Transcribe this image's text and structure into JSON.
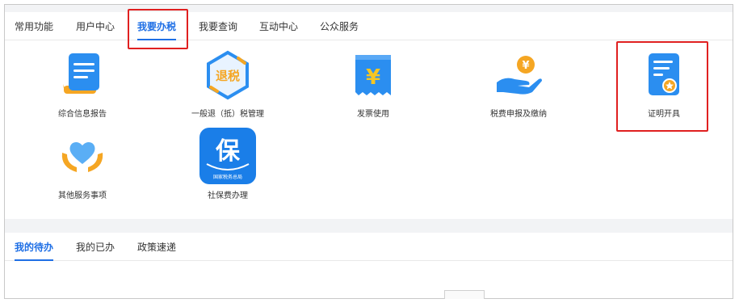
{
  "main_tabs": [
    {
      "label": "常用功能",
      "active": false
    },
    {
      "label": "用户中心",
      "active": false
    },
    {
      "label": "我要办税",
      "active": true
    },
    {
      "label": "我要查询",
      "active": false
    },
    {
      "label": "互动中心",
      "active": false
    },
    {
      "label": "公众服务",
      "active": false
    }
  ],
  "services": [
    {
      "label": "综合信息报告",
      "icon": "document-report-icon"
    },
    {
      "label": "一般退（抵）税管理",
      "icon": "tax-refund-hexagon-icon",
      "icon_text": "退税"
    },
    {
      "label": "发票使用",
      "icon": "invoice-yuan-icon",
      "icon_text": "¥"
    },
    {
      "label": "税费申报及缴纳",
      "icon": "hand-coin-icon",
      "icon_text": "¥"
    },
    {
      "label": "证明开具",
      "icon": "certificate-icon"
    },
    {
      "label": "其他服务事项",
      "icon": "heart-hands-icon"
    },
    {
      "label": "社保费办理",
      "icon": "social-insurance-icon",
      "icon_text": "保",
      "icon_subtext": "国家税务总局"
    }
  ],
  "bottom_tabs": [
    {
      "label": "我的待办",
      "active": true
    },
    {
      "label": "我的已办",
      "active": false
    },
    {
      "label": "政策速递",
      "active": false
    }
  ],
  "colors": {
    "accent": "#1f6fe5",
    "highlight": "#e02020",
    "icon_blue": "#2b8ef0",
    "icon_orange": "#f5a623"
  }
}
